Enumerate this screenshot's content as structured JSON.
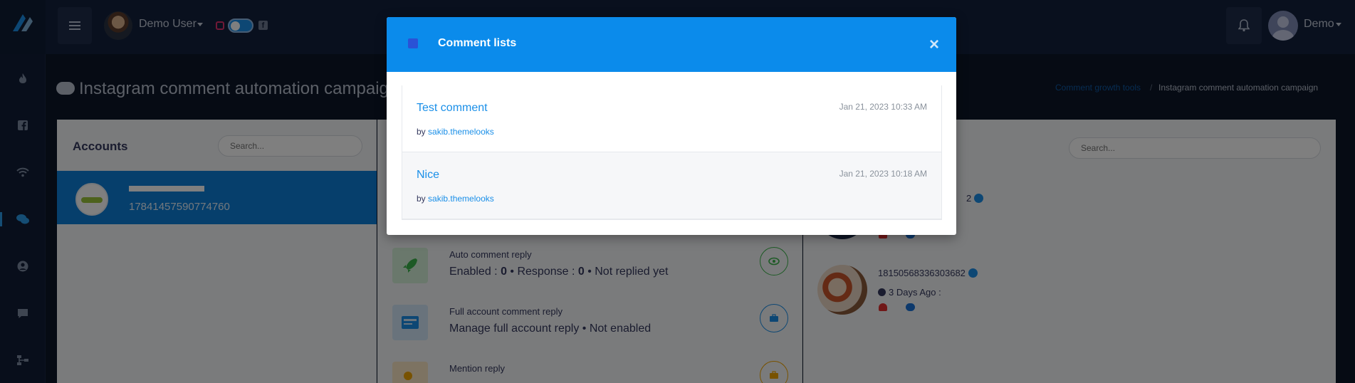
{
  "topbar": {
    "user_name": "Demo User",
    "account_name": "Demo"
  },
  "sidebar": {
    "items": [
      {
        "icon": "flame-icon"
      },
      {
        "icon": "facebook-icon"
      },
      {
        "icon": "wifi-icon"
      },
      {
        "icon": "comments-icon",
        "active": true
      },
      {
        "icon": "user-circle-icon"
      },
      {
        "icon": "comment-icon"
      },
      {
        "icon": "sitemap-icon"
      }
    ]
  },
  "page": {
    "title": "Instagram comment automation campaign",
    "breadcrumb": {
      "parent": "Comment growth tools",
      "separator": "/",
      "current": "Instagram comment automation campaign"
    }
  },
  "accounts": {
    "heading": "Accounts",
    "search_placeholder": "Search...",
    "selected": {
      "id": "17841457590774760"
    }
  },
  "features": [
    {
      "title": "Auto comment reply",
      "desc_prefix": "Enabled : ",
      "enabled": "0",
      "desc_mid": " • Response : ",
      "response": "0",
      "desc_suffix": " •  Not replied yet",
      "color": "#3bb54a"
    },
    {
      "title": "Full account comment reply",
      "desc": "Manage full account reply  •  Not enabled",
      "color": "#1a8fe8"
    },
    {
      "title": "Mention reply",
      "color": "#f0a500"
    }
  ],
  "posts": {
    "search_placeholder": "Search...",
    "items": [
      {
        "id_partial": "2"
      },
      {
        "id": "18150568336303682",
        "time": "3 Days Ago :"
      }
    ]
  },
  "modal": {
    "title": "Comment lists",
    "close": "×",
    "comments": [
      {
        "text": "Test comment",
        "time": "Jan 21, 2023 10:33 AM",
        "by_label": "by",
        "author": "sakib.themelooks"
      },
      {
        "text": "Nice",
        "time": "Jan 21, 2023 10:18 AM",
        "by_label": "by",
        "author": "sakib.themelooks"
      }
    ]
  },
  "colors": {
    "primary": "#0b8beb",
    "sidebar_bg": "#101d36",
    "topbar_bg": "#12213d"
  }
}
